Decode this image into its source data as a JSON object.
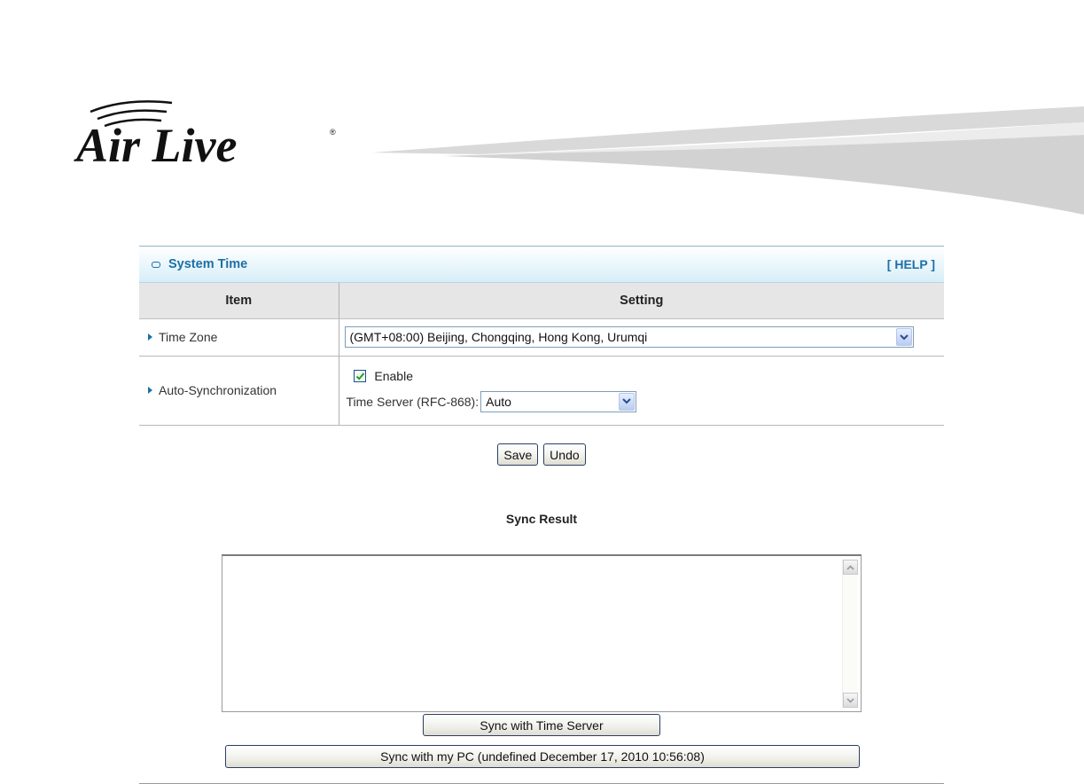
{
  "brand": {
    "name": "Air Live"
  },
  "panel": {
    "title": "System Time",
    "help_label": "[ HELP ]",
    "headers": {
      "item": "Item",
      "setting": "Setting"
    },
    "rows": {
      "time_zone": {
        "label": "Time Zone",
        "value": "(GMT+08:00) Beijing, Chongqing, Hong Kong, Urumqi"
      },
      "auto_sync": {
        "label": "Auto-Synchronization",
        "enable_label": "Enable",
        "enabled": true,
        "server_label": "Time Server (RFC-868):",
        "server_value": "Auto"
      }
    },
    "buttons": {
      "save": "Save",
      "undo": "Undo"
    }
  },
  "sync": {
    "result_label": "Sync Result",
    "result_text": "",
    "sync_server_label": "Sync with Time Server",
    "sync_pc_label": "Sync with my PC (undefined December 17, 2010 10:56:08)"
  },
  "colors": {
    "accent": "#1d6fa6",
    "header_bg": "#e6e6e6",
    "panel_header_bg": "#e9f6fc"
  }
}
